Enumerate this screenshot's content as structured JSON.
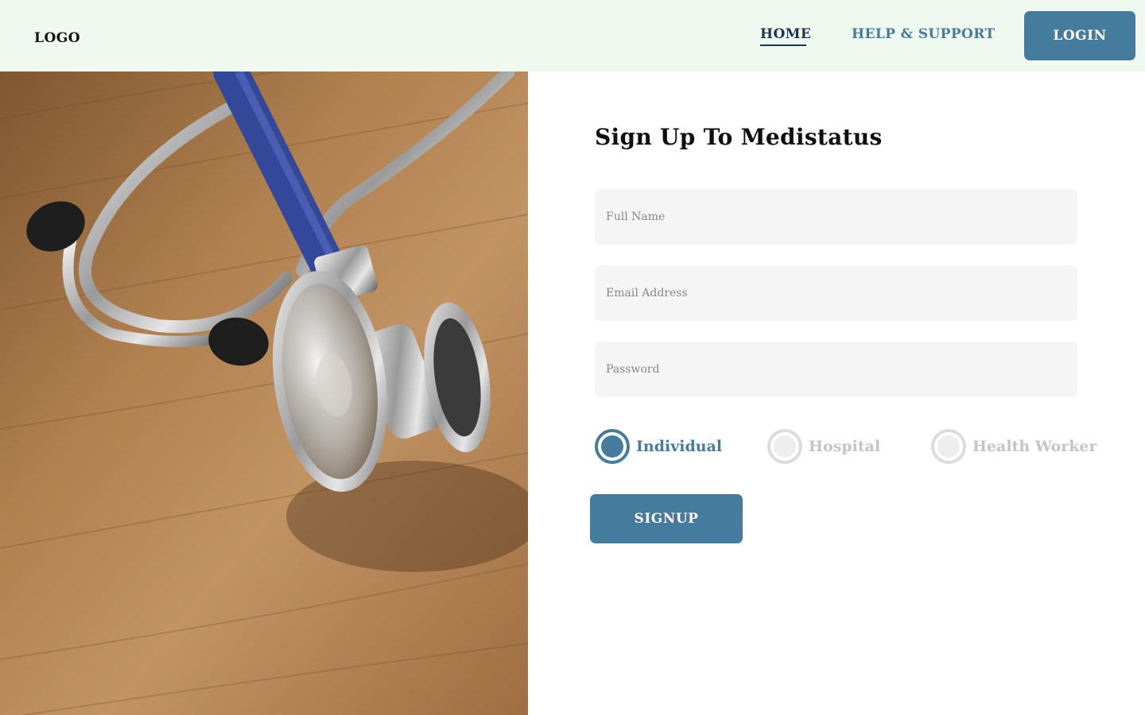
{
  "header": {
    "logo": "LOGO",
    "nav": {
      "home": "HOME",
      "help": "HELP & SUPPORT"
    },
    "login_label": "LOGIN"
  },
  "form": {
    "title": "Sign Up To Medistatus",
    "full_name_placeholder": "Full Name",
    "email_placeholder": "Email Address",
    "password_placeholder": "Password",
    "account_types": [
      {
        "label": "Individual",
        "selected": true
      },
      {
        "label": "Hospital",
        "selected": false
      },
      {
        "label": "Health Worker",
        "selected": false
      }
    ],
    "signup_label": "SIGNUP"
  },
  "hero": {
    "icon": "stethoscope-photo"
  },
  "colors": {
    "primary": "#457b9d",
    "header_bg": "#eff9ef",
    "nav_active": "#1c3552",
    "field_bg": "#f5f5f5",
    "inactive": "#c4c4c4"
  }
}
